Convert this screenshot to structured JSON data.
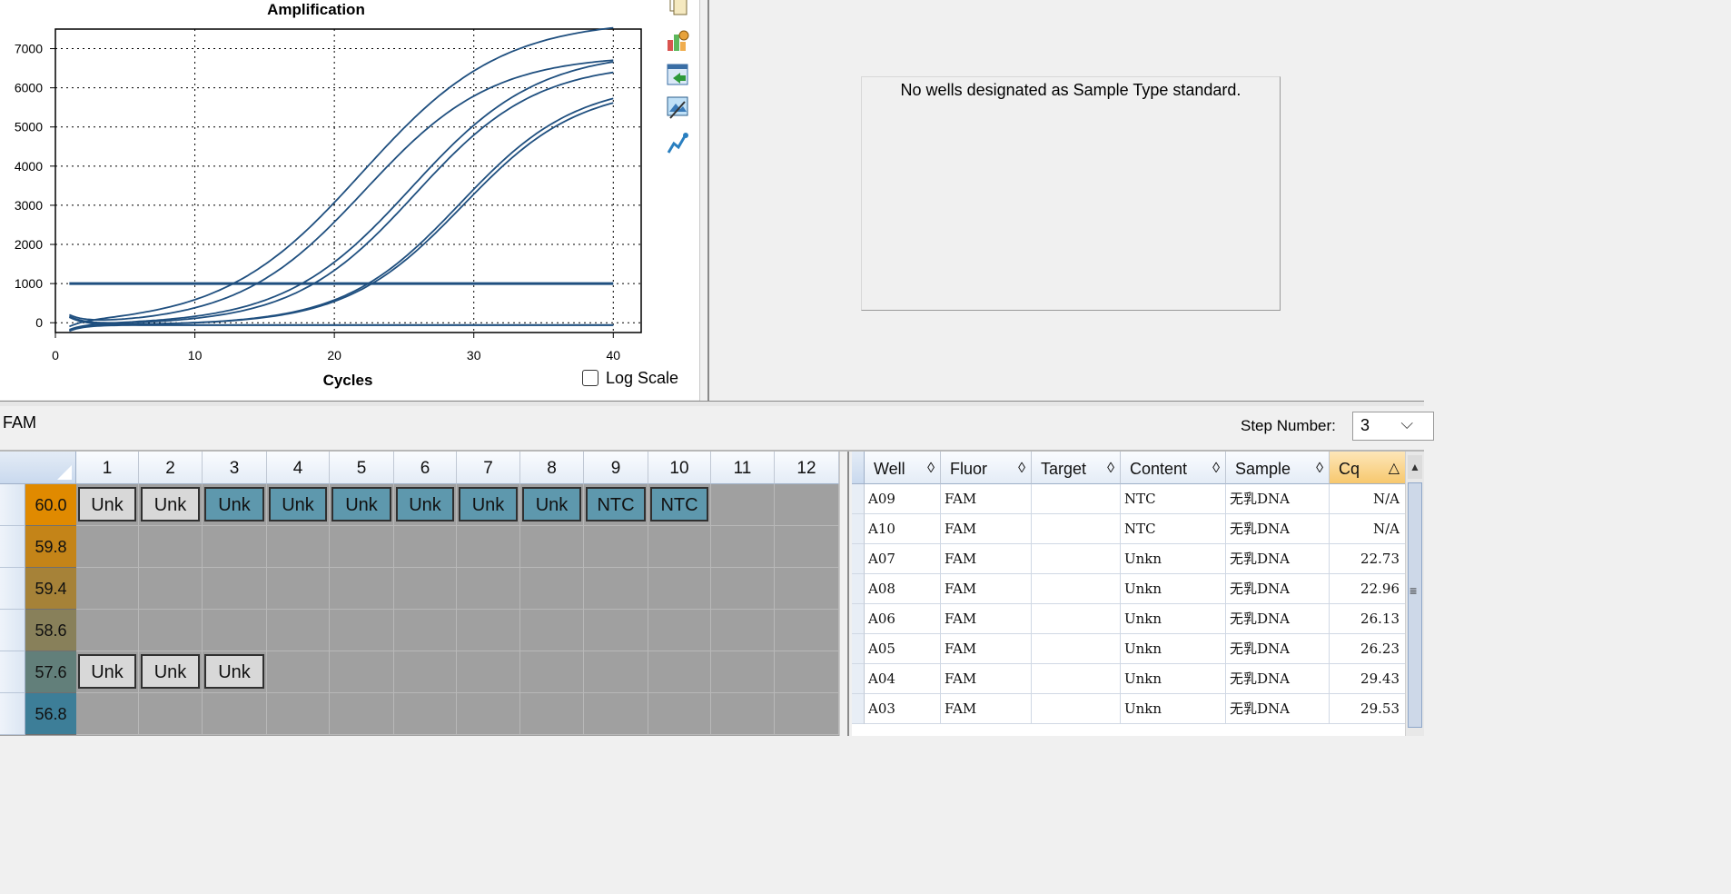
{
  "chart_panel": {
    "log_scale_label": "Log Scale",
    "log_scale_checked": false
  },
  "toolbar_icons": [
    "copy-icon",
    "chart-settings-icon",
    "export-icon",
    "image-icon",
    "curve-icon"
  ],
  "chart_data": {
    "type": "line",
    "title": "Amplification",
    "xlabel": "Cycles",
    "ylabel": "",
    "xlim": [
      0,
      42
    ],
    "ylim": [
      -250,
      7500
    ],
    "xticks": [
      0,
      10,
      20,
      30,
      40
    ],
    "yticks": [
      0,
      1000,
      2000,
      3000,
      4000,
      5000,
      6000,
      7000
    ],
    "grid": true,
    "threshold": 1000,
    "series_color": "#1f4f7f",
    "series": [
      {
        "params": [
          22.0,
          7800,
          0.2
        ]
      },
      {
        "params": [
          22.2,
          6900,
          0.22
        ]
      },
      {
        "params": [
          25.5,
          7000,
          0.22
        ]
      },
      {
        "params": [
          25.8,
          6700,
          0.23
        ]
      },
      {
        "params": [
          29.0,
          6200,
          0.24
        ]
      },
      {
        "params": [
          29.2,
          6100,
          0.24
        ]
      },
      {
        "params": [
          60.0,
          0,
          0.2
        ]
      },
      {
        "params": [
          60.0,
          0,
          0.2
        ]
      }
    ]
  },
  "std_curve": {
    "message": "No wells designated as Sample Type standard."
  },
  "mid_bar": {
    "fluor": "FAM",
    "step_label": "Step Number:",
    "step_value": "3"
  },
  "plate": {
    "columns": [
      "1",
      "2",
      "3",
      "4",
      "5",
      "6",
      "7",
      "8",
      "9",
      "10",
      "11",
      "12"
    ],
    "rows": [
      {
        "label": "",
        "temp": "60.0",
        "temp_color": "#e08a00",
        "wells": [
          "Unk",
          "Unk",
          "Unk",
          "Unk",
          "Unk",
          "Unk",
          "Unk",
          "Unk",
          "NTC",
          "NTC",
          "",
          ""
        ],
        "styles": [
          "g",
          "g",
          "t",
          "t",
          "t",
          "t",
          "t",
          "t",
          "t",
          "t",
          "",
          ""
        ]
      },
      {
        "label": "",
        "temp": "59.8",
        "temp_color": "#c48418",
        "wells": [
          "",
          "",
          "",
          "",
          "",
          "",
          "",
          "",
          "",
          "",
          "",
          ""
        ],
        "styles": [
          "",
          "",
          "",
          "",
          "",
          "",
          "",
          "",
          "",
          "",
          "",
          ""
        ]
      },
      {
        "label": "",
        "temp": "59.4",
        "temp_color": "#a68238",
        "wells": [
          "",
          "",
          "",
          "",
          "",
          "",
          "",
          "",
          "",
          "",
          "",
          ""
        ],
        "styles": [
          "",
          "",
          "",
          "",
          "",
          "",
          "",
          "",
          "",
          "",
          "",
          ""
        ]
      },
      {
        "label": "",
        "temp": "58.6",
        "temp_color": "#88805a",
        "wells": [
          "",
          "",
          "",
          "",
          "",
          "",
          "",
          "",
          "",
          "",
          "",
          ""
        ],
        "styles": [
          "",
          "",
          "",
          "",
          "",
          "",
          "",
          "",
          "",
          "",
          "",
          ""
        ]
      },
      {
        "label": "",
        "temp": "57.6",
        "temp_color": "#627f7a",
        "wells": [
          "Unk",
          "Unk",
          "Unk",
          "",
          "",
          "",
          "",
          "",
          "",
          "",
          "",
          ""
        ],
        "styles": [
          "g",
          "g",
          "g",
          "",
          "",
          "",
          "",
          "",
          "",
          "",
          "",
          ""
        ]
      },
      {
        "label": "",
        "temp": "56.8",
        "temp_color": "#3d7e98",
        "wells": [
          "",
          "",
          "",
          "",
          "",
          "",
          "",
          "",
          "",
          "",
          "",
          ""
        ],
        "styles": [
          "",
          "",
          "",
          "",
          "",
          "",
          "",
          "",
          "",
          "",
          "",
          ""
        ]
      }
    ]
  },
  "results": {
    "headers": [
      {
        "label": "Well",
        "sort": "◊"
      },
      {
        "label": "Fluor",
        "sort": "◊"
      },
      {
        "label": "Target",
        "sort": "◊"
      },
      {
        "label": "Content",
        "sort": "◊"
      },
      {
        "label": "Sample",
        "sort": "◊"
      },
      {
        "label": "Cq",
        "sort": "△"
      }
    ],
    "rows": [
      [
        "A09",
        "FAM",
        "",
        "NTC",
        "无乳DNA",
        "N/A"
      ],
      [
        "A10",
        "FAM",
        "",
        "NTC",
        "无乳DNA",
        "N/A"
      ],
      [
        "A07",
        "FAM",
        "",
        "Unkn",
        "无乳DNA",
        "22.73"
      ],
      [
        "A08",
        "FAM",
        "",
        "Unkn",
        "无乳DNA",
        "22.96"
      ],
      [
        "A06",
        "FAM",
        "",
        "Unkn",
        "无乳DNA",
        "26.13"
      ],
      [
        "A05",
        "FAM",
        "",
        "Unkn",
        "无乳DNA",
        "26.23"
      ],
      [
        "A04",
        "FAM",
        "",
        "Unkn",
        "无乳DNA",
        "29.43"
      ],
      [
        "A03",
        "FAM",
        "",
        "Unkn",
        "无乳DNA",
        "29.53"
      ]
    ]
  }
}
